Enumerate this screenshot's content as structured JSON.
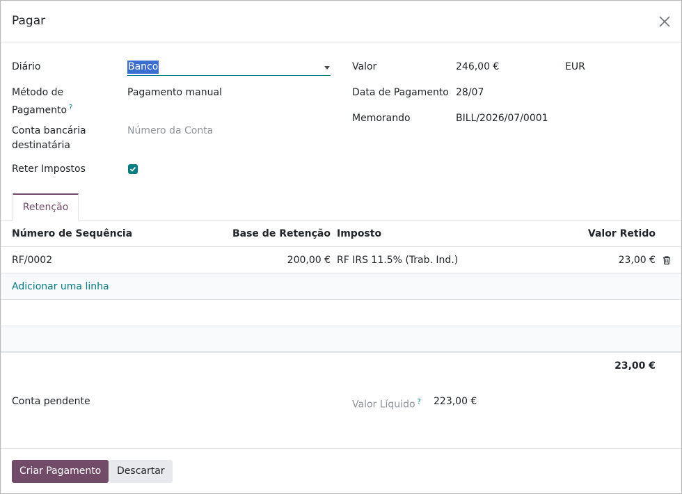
{
  "dialog": {
    "title": "Pagar"
  },
  "form": {
    "journal_label": "Diário",
    "journal_value": "Banco",
    "method_label_line1": "Método de",
    "method_label_line2": "Pagamento",
    "method_help": "?",
    "method_value": "Pagamento manual",
    "bank_label_line1": "Conta bancária",
    "bank_label_line2": "destinatária",
    "bank_placeholder": "Número da Conta",
    "withhold_label": "Reter Impostos",
    "withhold_checked": true,
    "amount_label": "Valor",
    "amount_value": "246,00 €",
    "currency": "EUR",
    "date_label": "Data de Pagamento",
    "date_value": "28/07",
    "memo_label": "Memorando",
    "memo_value": "BILL/2026/07/0001"
  },
  "tabs": [
    {
      "label": "Retenção",
      "active": true
    }
  ],
  "table": {
    "columns": [
      "Número de Sequência",
      "Base de Retenção",
      "Imposto",
      "Valor Retido"
    ],
    "rows": [
      {
        "sequence": "RF/0002",
        "base": "200,00 €",
        "tax": "RF IRS 11.5% (Trab. Ind.)",
        "withheld": "23,00 €"
      }
    ],
    "add_line": "Adicionar uma linha",
    "total": "23,00 €"
  },
  "summary": {
    "outstanding_label": "Conta pendente",
    "net_label": "Valor Líquido",
    "net_help": "?",
    "net_value": "223,00 €"
  },
  "footer": {
    "primary_label": "Criar Pagamento",
    "secondary_label": "Descartar"
  },
  "colors": {
    "accent": "#714b67",
    "link": "#017e84",
    "selection": "#3a6fd1"
  }
}
